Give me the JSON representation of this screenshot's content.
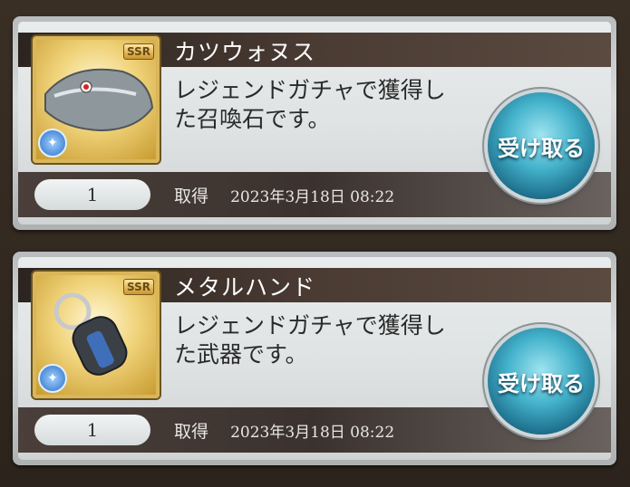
{
  "items": [
    {
      "name": "カツウォヌス",
      "description": "レジェンドガチャで獲得した召喚石です。",
      "quantity": "1",
      "obtained_label": "取得",
      "obtained_date": "2023年3月18日 08:22",
      "rarity": "SSR",
      "element_icon": "water-icon",
      "button_label": "受け取る"
    },
    {
      "name": "メタルハンド",
      "description": "レジェンドガチャで獲得した武器です。",
      "quantity": "1",
      "obtained_label": "取得",
      "obtained_date": "2023年3月18日 08:22",
      "rarity": "SSR",
      "element_icon": "water-icon",
      "button_label": "受け取る"
    }
  ]
}
